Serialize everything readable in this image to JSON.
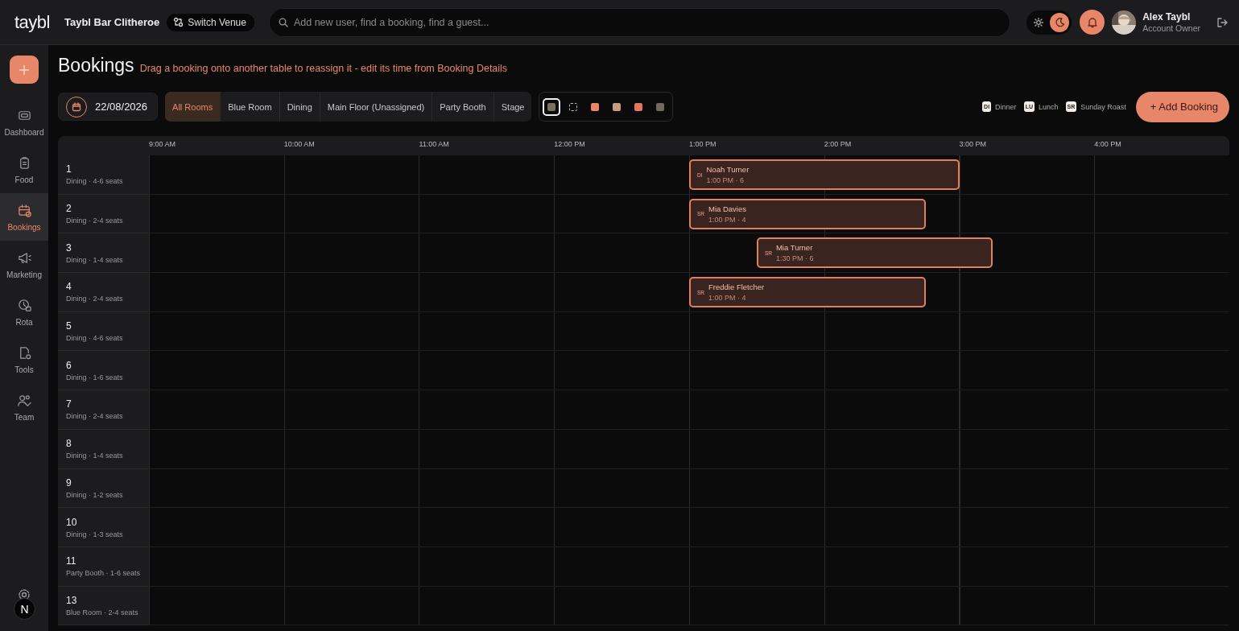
{
  "topbar": {
    "logo": "taybl",
    "venue": "Taybl Bar Clitheroe",
    "switch_venue": "Switch Venue",
    "search": {
      "placeholder": "Add new user, find a booking, find a guest..."
    },
    "theme": [
      {
        "kind": "light",
        "selected": false
      },
      {
        "kind": "dark",
        "selected": true
      }
    ],
    "user": {
      "name": "Alex Taybl",
      "role": "Account Owner"
    }
  },
  "sidebar": {
    "items": [
      {
        "kind": "dashboard",
        "label": "Dashboard",
        "selected": false
      },
      {
        "kind": "food",
        "label": "Food",
        "selected": false
      },
      {
        "kind": "bookings",
        "label": "Bookings",
        "selected": true
      },
      {
        "kind": "marketing",
        "label": "Marketing",
        "selected": false
      },
      {
        "kind": "rota",
        "label": "Rota",
        "selected": false
      },
      {
        "kind": "tools",
        "label": "Tools",
        "selected": false
      },
      {
        "kind": "team",
        "label": "Team",
        "selected": false
      }
    ],
    "dev_badge": "N"
  },
  "page": {
    "title": "Bookings",
    "hint": "Drag a booking onto another table to reassign it - edit its time from Booking Details"
  },
  "date": "22/08/2026",
  "room_filters": [
    {
      "label": "All Rooms",
      "selected": true
    },
    {
      "label": "Blue Room",
      "selected": false
    },
    {
      "label": "Dining",
      "selected": false
    },
    {
      "label": "Main Floor (Unassigned)",
      "selected": false
    },
    {
      "label": "Party Booth",
      "selected": false
    },
    {
      "label": "Stage",
      "selected": false
    }
  ],
  "swatches": [
    {
      "kind": "swatch",
      "color": "#7a7060",
      "selected": true
    },
    {
      "kind": "none",
      "selected": false
    },
    {
      "kind": "swatch",
      "color": "#e8866a",
      "selected": false
    },
    {
      "kind": "swatch",
      "color": "#c99b7e",
      "selected": false
    },
    {
      "kind": "swatch",
      "color": "#e0775e",
      "selected": false
    },
    {
      "kind": "swatch",
      "color": "#6f6a5c",
      "selected": false
    }
  ],
  "legend": [
    {
      "badge": "DI",
      "label": "Dinner"
    },
    {
      "badge": "LU",
      "label": "Lunch"
    },
    {
      "badge": "SR",
      "label": "Sunday Roast"
    }
  ],
  "add_booking": "+ Add Booking",
  "timeline": {
    "hours": [
      "9:00 AM",
      "10:00 AM",
      "11:00 AM",
      "12:00 PM",
      "1:00 PM",
      "2:00 PM",
      "3:00 PM",
      "4:00 PM"
    ],
    "tables": [
      {
        "name": "1",
        "detail": "Dining · 4-6 seats",
        "bookings": [
          {
            "kind": "dinner",
            "badge": "DI",
            "guest": "Noah Turner",
            "time": "1:00 PM · 6"
          }
        ]
      },
      {
        "name": "2",
        "detail": "Dining · 2-4 seats",
        "bookings": [
          {
            "kind": "sunday_roast",
            "badge": "SR",
            "guest": "Mia Davies",
            "time": "1:00 PM · 4"
          }
        ]
      },
      {
        "name": "3",
        "detail": "Dining · 1-4 seats",
        "bookings": [
          {
            "kind": "sunday_roast",
            "badge": "SR",
            "guest": "Mia Turner",
            "time": "1:30 PM · 6"
          }
        ]
      },
      {
        "name": "4",
        "detail": "Dining · 2-4 seats",
        "bookings": [
          {
            "kind": "sunday_roast",
            "badge": "SR",
            "guest": "Freddie Fletcher",
            "time": "1:00 PM · 4"
          }
        ]
      },
      {
        "name": "5",
        "detail": "Dining · 4-6 seats"
      },
      {
        "name": "6",
        "detail": "Dining · 1-6 seats"
      },
      {
        "name": "7",
        "detail": "Dining · 2-4 seats"
      },
      {
        "name": "8",
        "detail": "Dining · 1-4 seats"
      },
      {
        "name": "9",
        "detail": "Dining · 1-2 seats"
      },
      {
        "name": "10",
        "detail": "Dining · 1-3 seats"
      },
      {
        "name": "11",
        "detail": "Party Booth · 1-6 seats"
      },
      {
        "name": "13",
        "detail": "Blue Room · 2-4 seats"
      }
    ]
  }
}
